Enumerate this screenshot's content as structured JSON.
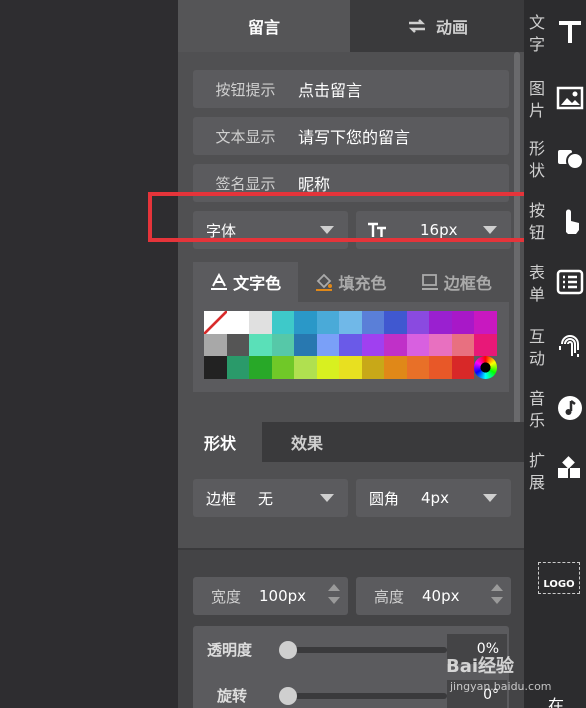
{
  "tabs": {
    "message": "留言",
    "animation": "动画"
  },
  "fields": [
    {
      "label": "按钮提示",
      "value": "点击留言"
    },
    {
      "label": "文本显示",
      "value": "请写下您的留言"
    },
    {
      "label": "签名显示",
      "value": "昵称"
    }
  ],
  "font_select": {
    "label": "字体"
  },
  "font_size": {
    "value": "16px"
  },
  "color_tabs": {
    "text_color": "文字色",
    "fill_color": "填充色",
    "border_color": "边框色"
  },
  "palette": [
    "#ffffff",
    "#ffffff",
    "#e0e0e0",
    "#3ec9c9",
    "#2a98c8",
    "#4aaad8",
    "#70b8e8",
    "#5a7fd8",
    "#4058d0",
    "#8a4ae0",
    "#9a20d0",
    "#a818c8",
    "#c818c0",
    "#a8a8a8",
    "#555555",
    "#5ae0b8",
    "#56c8a8",
    "#2878b0",
    "#7aa0f8",
    "#6a5ae8",
    "#a040f0",
    "#c030c8",
    "#d860e0",
    "#e870c0",
    "#e87080",
    "#e81878",
    "#222222",
    "#2a9a6a",
    "#28a828",
    "#70c828",
    "#b0e050",
    "#d8f020",
    "#e8e020",
    "#c8a818",
    "#e08818",
    "#e87028",
    "#e85828",
    "#d82828",
    "#000000"
  ],
  "shape_tabs": {
    "shape": "形状",
    "effect": "效果"
  },
  "border": {
    "label": "边框",
    "value": "无"
  },
  "radius": {
    "label": "圆角",
    "value": "4px"
  },
  "width": {
    "label": "宽度",
    "value": "100px"
  },
  "height": {
    "label": "高度",
    "value": "40px"
  },
  "opacity": {
    "label": "透明度",
    "value": "0%"
  },
  "rotate": {
    "label": "旋转",
    "value": "0°"
  },
  "rail": [
    {
      "label": "文字",
      "icon": "text-icon"
    },
    {
      "label": "图片",
      "icon": "image-icon"
    },
    {
      "label": "形状",
      "icon": "shapes-icon"
    },
    {
      "label": "按钮",
      "icon": "hand-pointer-icon"
    },
    {
      "label": "表单",
      "icon": "form-list-icon"
    },
    {
      "label": "互动",
      "icon": "fingerprint-icon"
    },
    {
      "label": "音乐",
      "icon": "music-icon"
    },
    {
      "label": "扩展",
      "icon": "blocks-icon"
    }
  ],
  "logo_label": "LOGO",
  "rail_bottom": "在",
  "watermark": {
    "brand": "Bai经验",
    "url": "jingyan.baidu.com"
  },
  "colors": {
    "highlight": "#e5343a",
    "panel": "#444446"
  }
}
